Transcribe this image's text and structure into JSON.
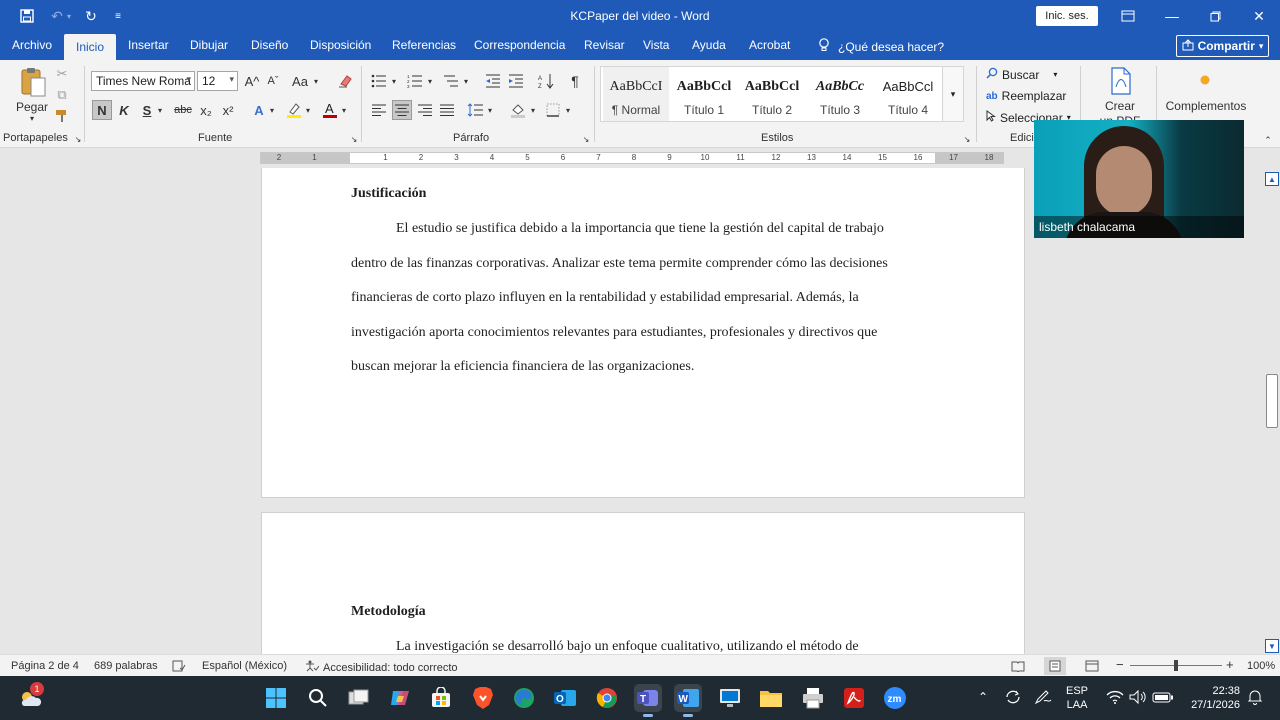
{
  "window": {
    "title": "KCPaper del video  -  Word",
    "signin_label": "Inic. ses."
  },
  "tabs": [
    "Archivo",
    "Inicio",
    "Insertar",
    "Dibujar",
    "Diseño",
    "Disposición",
    "Referencias",
    "Correspondencia",
    "Revisar",
    "Vista",
    "Ayuda",
    "Acrobat"
  ],
  "active_tab": "Inicio",
  "tell_me": "¿Qué desea hacer?",
  "share_label": "Compartir",
  "ribbon": {
    "clipboard": {
      "paste_label": "Pegar",
      "group_label": "Portapapeles"
    },
    "font": {
      "font_name": "Times New Roma",
      "font_size": "12",
      "group_label": "Fuente",
      "bold": "N",
      "italic": "K",
      "underline": "S",
      "strike": "abc",
      "subscript": "x₂",
      "superscript": "x²",
      "grow": "A^",
      "shrink": "Aˇ",
      "case": "Aa"
    },
    "paragraph": {
      "group_label": "Párrafo",
      "pilcrow": "¶"
    },
    "styles": {
      "group_label": "Estilos",
      "items": [
        {
          "preview": "AaBbCcI",
          "name": "¶ Normal"
        },
        {
          "preview": "AaBbCcl",
          "name": "Título 1"
        },
        {
          "preview": "AaBbCcl",
          "name": "Título 2"
        },
        {
          "preview": "AaBbCc",
          "name": "Título 3"
        },
        {
          "preview": "AaBbCcl",
          "name": "Título 4"
        }
      ]
    },
    "editing": {
      "group_label": "Edici",
      "find": "Buscar",
      "replace": "Reemplazar",
      "select": "Seleccionar"
    },
    "acrobat": {
      "create_label": "Crear",
      "create_sub": "un PDF"
    },
    "addins": {
      "label": "Complementos"
    }
  },
  "ruler_ticks": [
    "2",
    "1",
    "1",
    "2",
    "3",
    "4",
    "5",
    "6",
    "7",
    "8",
    "9",
    "10",
    "11",
    "12",
    "13",
    "14",
    "15",
    "16",
    "17",
    "18"
  ],
  "document": {
    "page1": {
      "heading": "Justificación",
      "lines": [
        "El estudio se justifica debido a la importancia que tiene la gestión del capital de trabajo",
        "dentro de las finanzas corporativas. Analizar este tema permite comprender cómo las decisiones",
        "financieras de corto plazo influyen en la rentabilidad y estabilidad empresarial. Además, la",
        "investigación aporta conocimientos relevantes para estudiantes, profesionales y directivos que",
        "buscan mejorar la eficiencia financiera de las organizaciones."
      ]
    },
    "page2": {
      "heading": "Metodología",
      "lines": [
        "La investigación se desarrolló bajo un enfoque cualitativo, utilizando el método de"
      ]
    }
  },
  "webcam": {
    "name": "lisbeth chalacama"
  },
  "status": {
    "page": "Página 2 de 4",
    "words": "689 palabras",
    "language": "Español (México)",
    "accessibility": "Accesibilidad: todo correcto",
    "zoom": "100%"
  },
  "taskbar": {
    "notification_count": "1",
    "language": "ESP",
    "layout": "LAA",
    "time": "22:38",
    "date": "27/1/2026"
  },
  "colors": {
    "title_bar": "#1f5ab8",
    "taskbar": "#202a33"
  }
}
